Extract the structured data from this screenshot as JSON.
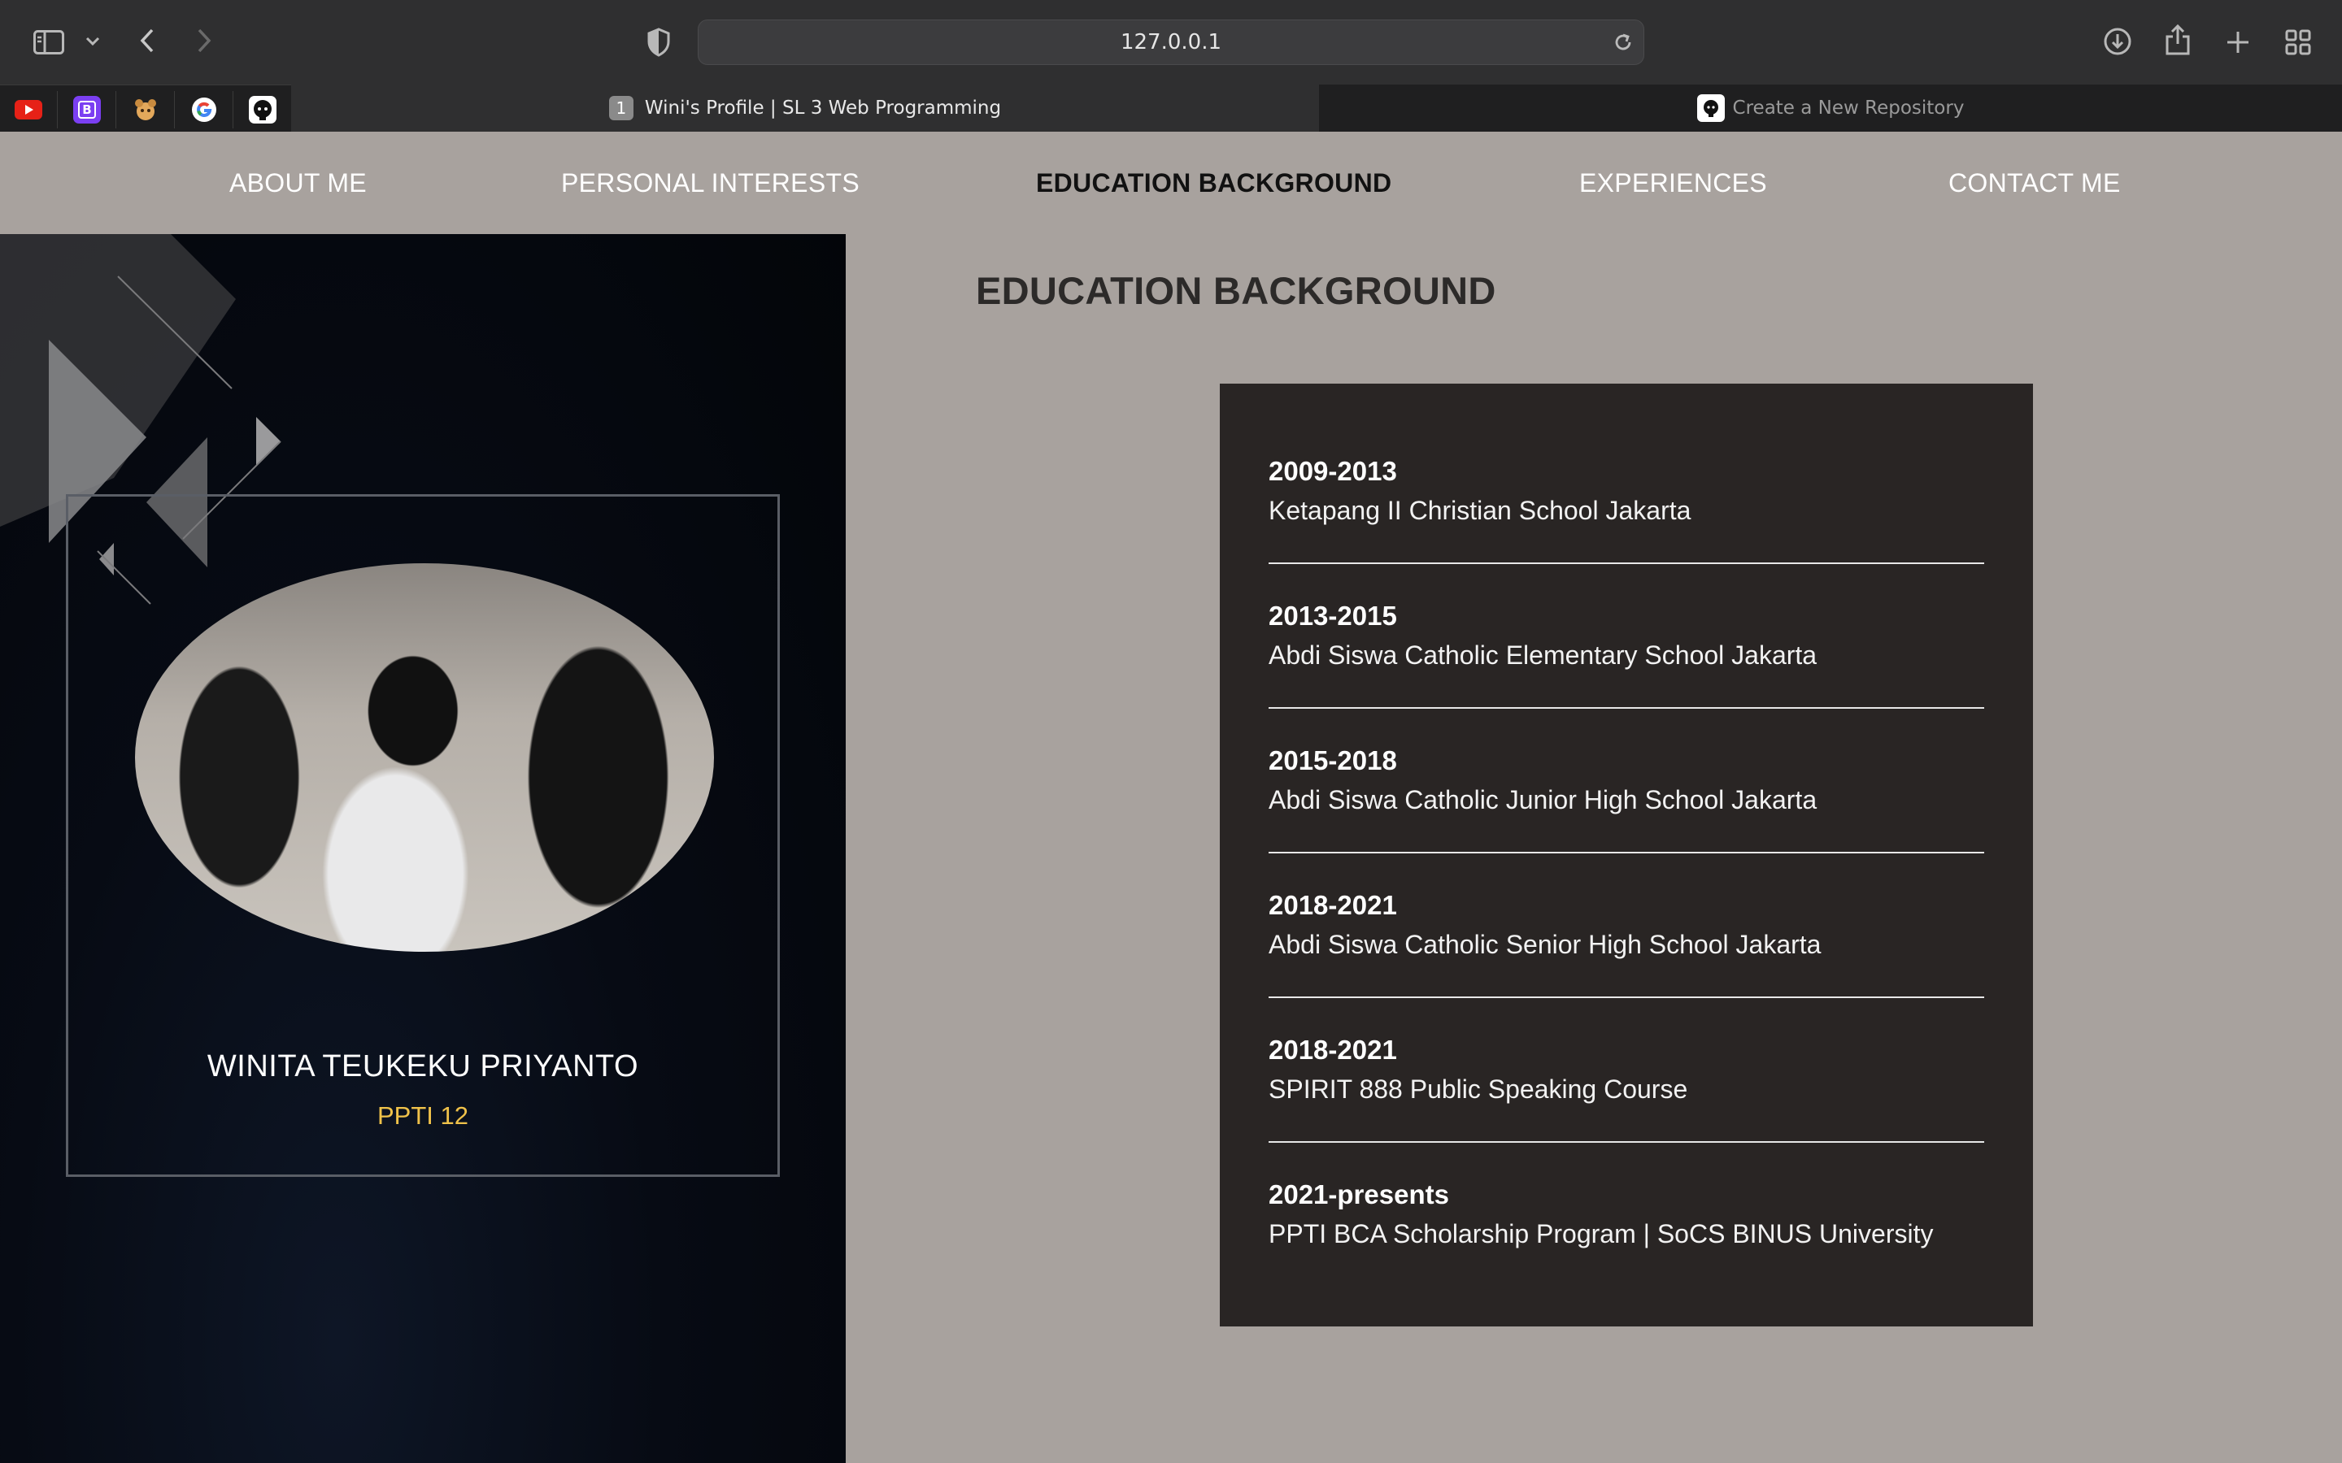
{
  "browser": {
    "url": "127.0.0.1",
    "tabs": [
      {
        "label": "Wini's Profile | SL 3 Web Programming",
        "badge": "1",
        "active": true
      },
      {
        "label": "Create a New Repository",
        "active": false
      }
    ],
    "favorites": [
      "youtube-icon",
      "bootstrap-icon",
      "extension-icon",
      "google-icon",
      "github-icon"
    ],
    "bootstrap_letter": "B"
  },
  "nav": {
    "items": [
      {
        "label": "ABOUT ME",
        "active": false
      },
      {
        "label": "PERSONAL INTERESTS",
        "active": false
      },
      {
        "label": "EDUCATION BACKGROUND",
        "active": true
      },
      {
        "label": "EXPERIENCES",
        "active": false
      },
      {
        "label": "CONTACT ME",
        "active": false
      }
    ]
  },
  "profile": {
    "name": "WINITA TEUKEKU PRIYANTO",
    "subtitle": "PPTI 12",
    "subtitle_color": "#f0c24a"
  },
  "main": {
    "title": "EDUCATION BACKGROUND",
    "education": [
      {
        "years": "2009-2013",
        "school": "Ketapang II Christian School Jakarta"
      },
      {
        "years": "2013-2015",
        "school": "Abdi Siswa Catholic Elementary School Jakarta"
      },
      {
        "years": "2015-2018",
        "school": "Abdi Siswa Catholic Junior High School Jakarta"
      },
      {
        "years": "2018-2021",
        "school": "Abdi Siswa Catholic Senior High School Jakarta"
      },
      {
        "years": "2018-2021",
        "school": "SPIRIT 888 Public Speaking Course"
      },
      {
        "years": "2021-presents",
        "school": "PPTI BCA Scholarship Program | SoCS BINUS University"
      }
    ]
  },
  "colors": {
    "page_bg": "#a8a29e",
    "card_bg": "#292524",
    "sidebar_bg": "#05080f"
  }
}
